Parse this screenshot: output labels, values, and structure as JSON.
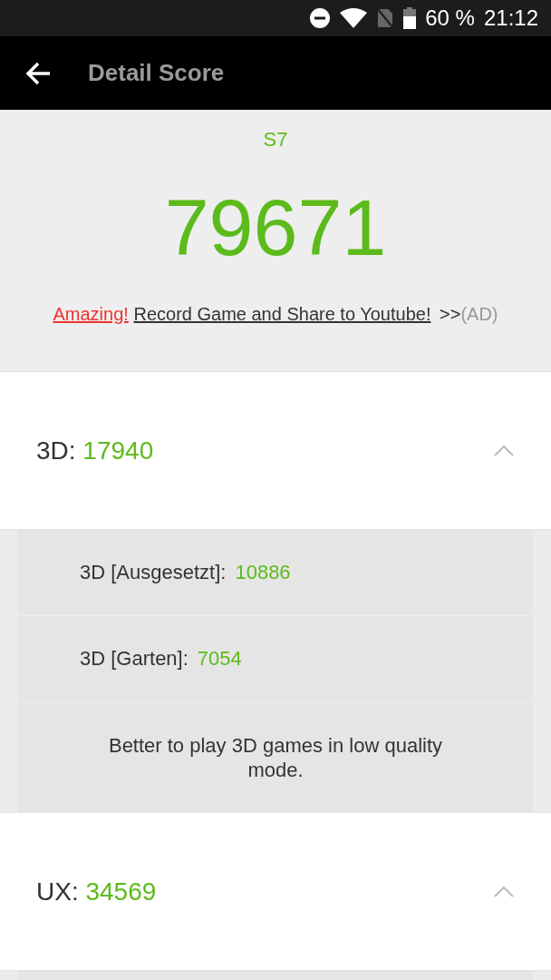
{
  "status_bar": {
    "battery": "60 %",
    "time": "21:12"
  },
  "app_bar": {
    "title": "Detail Score"
  },
  "summary": {
    "device": "S7",
    "score": "79671",
    "promo": {
      "highlight": "Amazing!",
      "link": "Record Game and Share to Youtube!",
      "arrows": ">>",
      "ad": "(AD)"
    }
  },
  "sections": [
    {
      "label": "3D:",
      "score": "17940",
      "expanded": true,
      "items": [
        {
          "kind": "score",
          "label": "3D [Ausgesetzt]:",
          "value": "10886"
        },
        {
          "kind": "score",
          "label": "3D [Garten]:",
          "value": "7054"
        },
        {
          "kind": "note",
          "text": "Better to play 3D games in low quality mode."
        }
      ]
    },
    {
      "label": "UX:",
      "score": "34569",
      "expanded": true
    }
  ]
}
